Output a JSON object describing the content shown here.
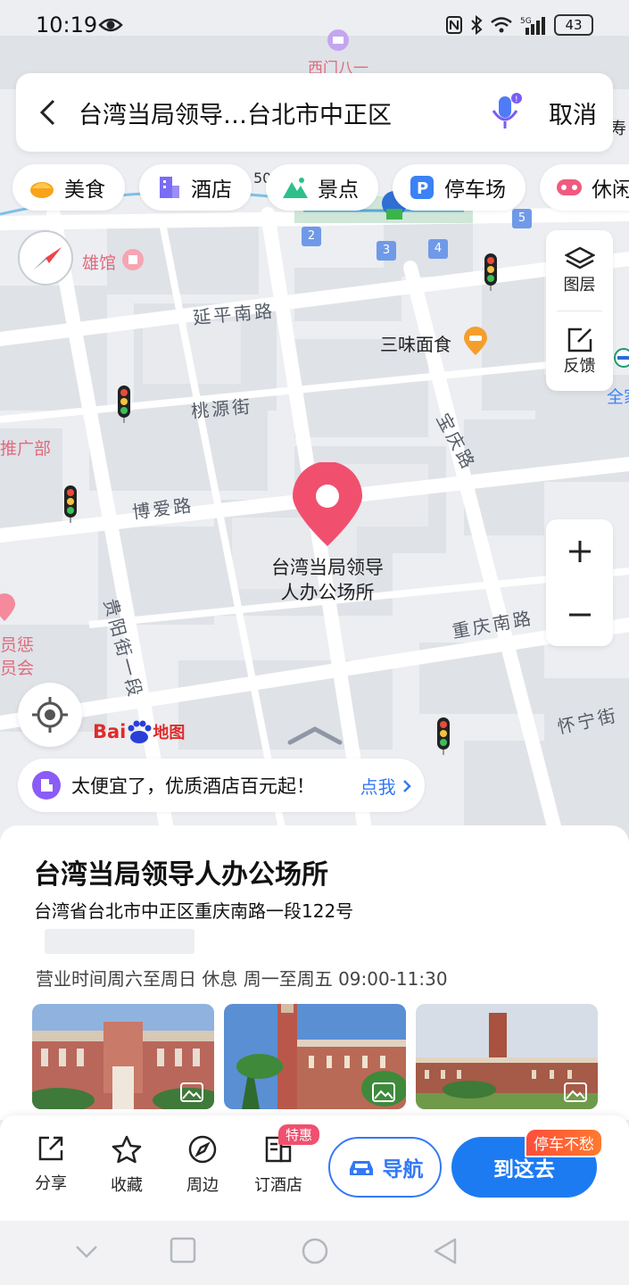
{
  "status_bar": {
    "time": "10:19",
    "battery": "43",
    "network": "5G"
  },
  "search": {
    "query": "台湾当局领导…台北市中正区",
    "cancel_label": "取消"
  },
  "chips": [
    {
      "label": "美食",
      "icon": "food-icon"
    },
    {
      "label": "酒店",
      "icon": "hotel-icon"
    },
    {
      "label": "景点",
      "icon": "scenic-icon"
    },
    {
      "label": "停车场",
      "icon": "parking-icon"
    },
    {
      "label": "休闲",
      "icon": "leisure-icon"
    }
  ],
  "tools": {
    "layers_label": "图层",
    "feedback_label": "反馈"
  },
  "map": {
    "labels": {
      "ximen": "西门八一",
      "elevation": "50'",
      "museum": "雄馆",
      "yanping": "延平南路",
      "taoyuan": "桃源街",
      "boai": "博爱路",
      "baoqing": "宝庆路",
      "guiyang": "贵阳街一段",
      "chongqing": "重庆南路",
      "huaining": "怀宁街",
      "sanwei": "三味面食",
      "tuiguang": "推广部",
      "yuan_top": "员惩",
      "yuan_bottom": "员会",
      "quanjia": "全家",
      "shou": "寿"
    },
    "platforms": [
      "2",
      "3",
      "4",
      "5"
    ],
    "marker_label_line1": "台湾当局领导",
    "marker_label_line2": "人办公场所",
    "baidu_logo": "Bai",
    "baidu_logo_suffix": "地图"
  },
  "hotel_ad": {
    "text": "太便宜了，优质酒店百元起！",
    "link": "点我"
  },
  "place": {
    "title": "台湾当局领导人办公场所",
    "address": "台湾省台北市中正区重庆南路一段122号",
    "hours": "营业时间周六至周日 休息 周一至周五 09:00-11:30"
  },
  "actions": {
    "share": "分享",
    "favorite": "收藏",
    "nearby": "周边",
    "book_hotel": "订酒店",
    "deal_badge": "特惠",
    "navigate": "导航",
    "go_here": "到这去",
    "parking_badge": "停车不愁"
  },
  "colors": {
    "accent": "#1d7bf2",
    "marker": "#f0506e",
    "map_bg": "#eceef2"
  }
}
